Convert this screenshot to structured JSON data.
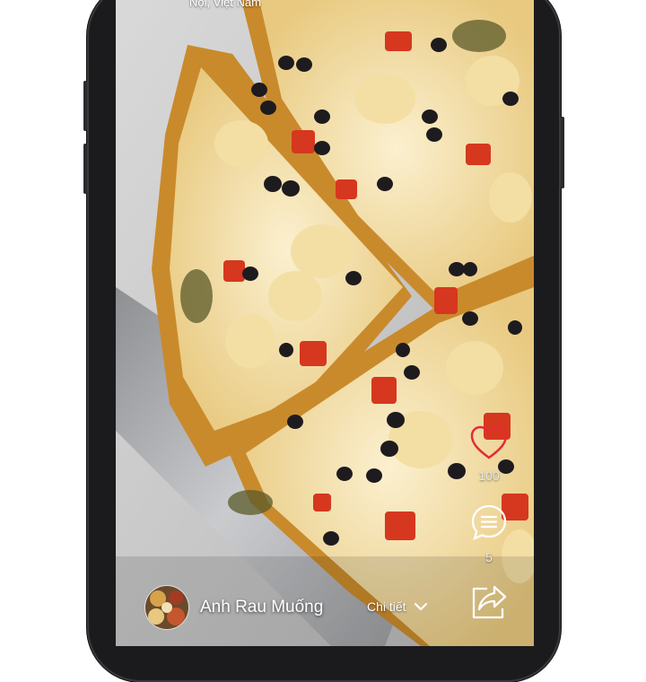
{
  "post": {
    "location": "Nội, Việt Nam",
    "author_name": "Anh Rau Muống",
    "detail_label": "Chi tiết",
    "image_subject": "pizza-photo"
  },
  "actions": {
    "likes": "100",
    "comments": "5"
  },
  "icons": {
    "like": "heart-icon",
    "comment": "comment-bubble-icon",
    "share": "share-icon",
    "detail": "chevron-down-icon"
  },
  "colors": {
    "heart": "#e52a35",
    "text": "#ffffff",
    "phone_frame": "#1b1b1d"
  }
}
